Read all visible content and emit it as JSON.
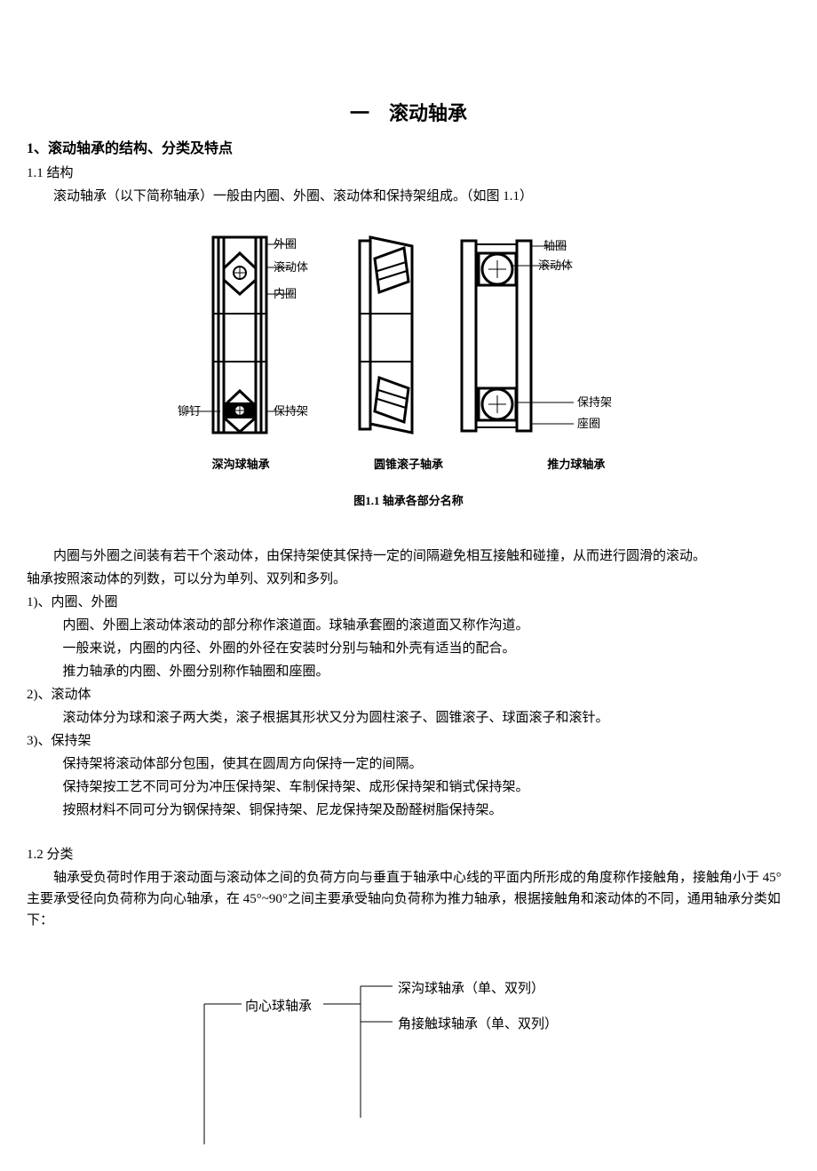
{
  "title": "一　滚动轴承",
  "h_sec1": "1、滚动轴承的结构、分类及特点",
  "s11": "1.1 结构",
  "p11a": "滚动轴承（以下简称轴承）一般由内圈、外圈、滚动体和保持架组成。（如图 1.1）",
  "fig": {
    "outer": "外圈",
    "roller": "滚动体",
    "inner": "内圈",
    "axle": "轴圈",
    "rivet": "铆钉",
    "cage": "保持架",
    "seat": "座圈",
    "cap1": "深沟球轴承",
    "cap2": "圆锥滚子轴承",
    "cap3": "推力球轴承",
    "caption": "图1.1  轴承各部分名称"
  },
  "p12a": "内圈与外圈之间装有若干个滚动体，由保持架使其保持一定的间隔避免相互接触和碰撞，从而进行圆滑的滚动。",
  "p12b": "轴承按照滚动体的列数，可以分为单列、双列和多列。",
  "h121": "1)、内圈、外圈",
  "p121a": "内圈、外圈上滚动体滚动的部分称作滚道面。球轴承套圈的滚道面又称作沟道。",
  "p121b": "一般来说，内圈的内径、外圈的外径在安装时分别与轴和外壳有适当的配合。",
  "p121c": "推力轴承的内圈、外圈分别称作轴圈和座圈。",
  "h122": "2)、滚动体",
  "p122a": "滚动体分为球和滚子两大类，滚子根据其形状又分为圆柱滚子、圆锥滚子、球面滚子和滚针。",
  "h123": "3)、保持架",
  "p123a": "保持架将滚动体部分包围，使其在圆周方向保持一定的间隔。",
  "p123b": "保持架按工艺不同可分为冲压保持架、车制保持架、成形保持架和销式保持架。",
  "p123c": "按照材料不同可分为钢保持架、铜保持架、尼龙保持架及酚醛树脂保持架。",
  "s12": "1.2 分类",
  "p12c": "轴承受负荷时作用于滚动面与滚动体之间的负荷方向与垂直于轴承中心线的平面内所形成的角度称作接触角，接触角小于 45°主要承受径向负荷称为向心轴承，在 45°~90°之间主要承受轴向负荷称为推力轴承，根据接触角和滚动体的不同，通用轴承分类如下：",
  "tree": {
    "node1": "向心球轴承",
    "leaf1": "深沟球轴承（单、双列）",
    "leaf2": "角接触球轴承（单、双列）"
  }
}
